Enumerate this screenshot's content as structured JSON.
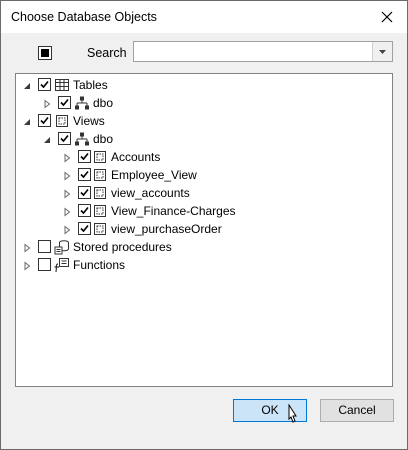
{
  "dialog": {
    "title": "Choose Database Objects"
  },
  "toolbar": {
    "search_label": "Search",
    "search_value": ""
  },
  "tree": {
    "tables": {
      "label": "Tables",
      "checked": true,
      "expanded": true,
      "children": [
        {
          "label": "dbo",
          "checked": true,
          "expanded": false
        }
      ]
    },
    "views": {
      "label": "Views",
      "checked": true,
      "expanded": true,
      "children": [
        {
          "label": "dbo",
          "checked": true,
          "expanded": true,
          "children": [
            {
              "label": "Accounts",
              "checked": true
            },
            {
              "label": "Employee_View",
              "checked": true
            },
            {
              "label": "view_accounts",
              "checked": true
            },
            {
              "label": "View_Finance-Charges",
              "checked": true
            },
            {
              "label": "view_purchaseOrder",
              "checked": true
            }
          ]
        }
      ]
    },
    "stored_procedures": {
      "label": "Stored procedures",
      "checked": false,
      "expanded": false
    },
    "functions": {
      "label": "Functions",
      "checked": false,
      "expanded": false
    }
  },
  "buttons": {
    "ok": "OK",
    "cancel": "Cancel"
  },
  "icons": {
    "close": "close-icon",
    "select_all": "select-all-toggle-icon",
    "dropdown": "chevron-down-icon",
    "table": "table-grid-icon",
    "view": "view-icon",
    "schema": "schema-hierarchy-icon",
    "stored_procedure": "stored-procedure-icon",
    "function": "function-icon",
    "cursor": "mouse-pointer-icon"
  }
}
